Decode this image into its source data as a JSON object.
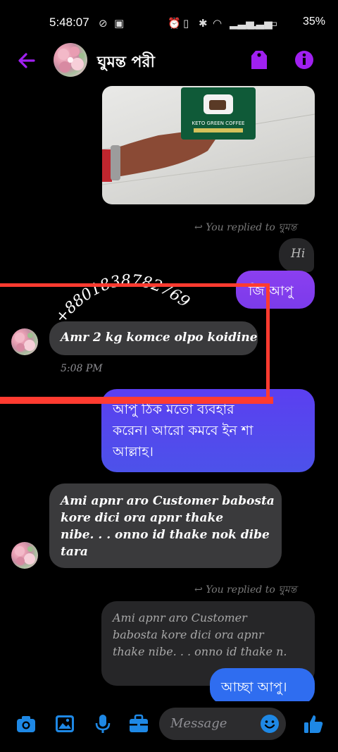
{
  "status_bar": {
    "time": "5:48:07",
    "battery": "35%"
  },
  "header": {
    "contact_name": "ঘুমন্ত পরী"
  },
  "image_card": {
    "product_title": "KETO GREEN COFFEE"
  },
  "messages": {
    "reply_note_1": "You replied to ঘুমন্ত",
    "reply_quote_1": "Hi",
    "sent_1": "জি আপু",
    "watermark_number": "+8801838782769",
    "received_1": "Amr 2 kg komce olpo koidine",
    "timestamp_1": "5:08 PM",
    "sent_2_lines": [
      "আপু ঠিক মতো ব্যবহার",
      "করেন। আরো কমবে ইন শা",
      "আল্লাহ।"
    ],
    "received_2_lines": [
      "Ami apnr aro Customer babosta",
      "kore dici ora apnr thake",
      "nibe. . . onno id thake nok dibe",
      "tara"
    ],
    "reply_note_2": "You replied to ঘুমন্ত",
    "reply_quote_2_lines": [
      "Ami apnr aro Customer",
      "babosta kore dici ora apnr",
      "thake nibe. . . onno id thake n."
    ],
    "sent_3": "আচ্ছা আপু।"
  },
  "composer": {
    "placeholder": "Message"
  },
  "colors": {
    "accent_purple": "#8a2be2",
    "blue_bubble_top": "#7c3aed",
    "blue_bubble_bottom": "#4f46e5",
    "red_overlay": "#ff3b30",
    "composer_blue": "#1e88e5"
  }
}
